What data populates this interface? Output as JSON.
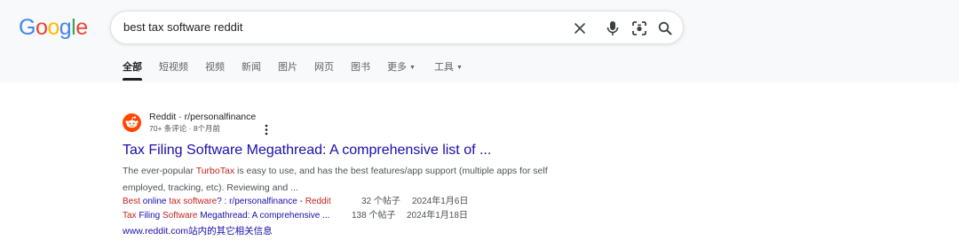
{
  "logo": {
    "letters": [
      "G",
      "o",
      "o",
      "g",
      "l",
      "e"
    ],
    "colors": [
      "#4285f4",
      "#ea4335",
      "#fbbc05",
      "#4285f4",
      "#34a853",
      "#ea4335"
    ]
  },
  "search": {
    "query": "best tax software reddit"
  },
  "tabs": [
    {
      "label": "全部"
    },
    {
      "label": "短视频"
    },
    {
      "label": "视频"
    },
    {
      "label": "新闻"
    },
    {
      "label": "图片"
    },
    {
      "label": "网页"
    },
    {
      "label": "图书"
    },
    {
      "label": "更多"
    },
    {
      "label": "工具"
    }
  ],
  "result": {
    "site_name": "Reddit · r/personalfinance",
    "site_meta": "70+ 条评论 · 8个月前",
    "title": "Tax Filing Software Megathread: A comprehensive list of ...",
    "snippet": {
      "before": "The ever-popular ",
      "highlight": "TurboTax",
      "after": " is easy to use, and has the best features/app support (multiple apps for self employed, tracking, etc). Reviewing and ..."
    },
    "sub_links": [
      {
        "parts": [
          {
            "text": "Best",
            "hl": true
          },
          {
            "text": " online ",
            "hl": false
          },
          {
            "text": "tax software",
            "hl": true
          },
          {
            "text": "? : r/personalfinance - ",
            "hl": false
          },
          {
            "text": "Reddit",
            "hl": true
          }
        ],
        "count": "32 个帖子",
        "date": "2024年1月6日"
      },
      {
        "parts": [
          {
            "text": "Tax",
            "hl": true
          },
          {
            "text": " Filing ",
            "hl": false
          },
          {
            "text": "Software",
            "hl": true
          },
          {
            "text": " Megathread: A comprehensive ...",
            "hl": false
          }
        ],
        "count": "138 个帖子",
        "date": "2024年1月18日"
      }
    ],
    "more_from_site": "www.reddit.com站内的其它相关信息"
  },
  "colors": {
    "link": "#1a0dab",
    "highlight": "#c5221f",
    "reddit": "#ff4500"
  }
}
